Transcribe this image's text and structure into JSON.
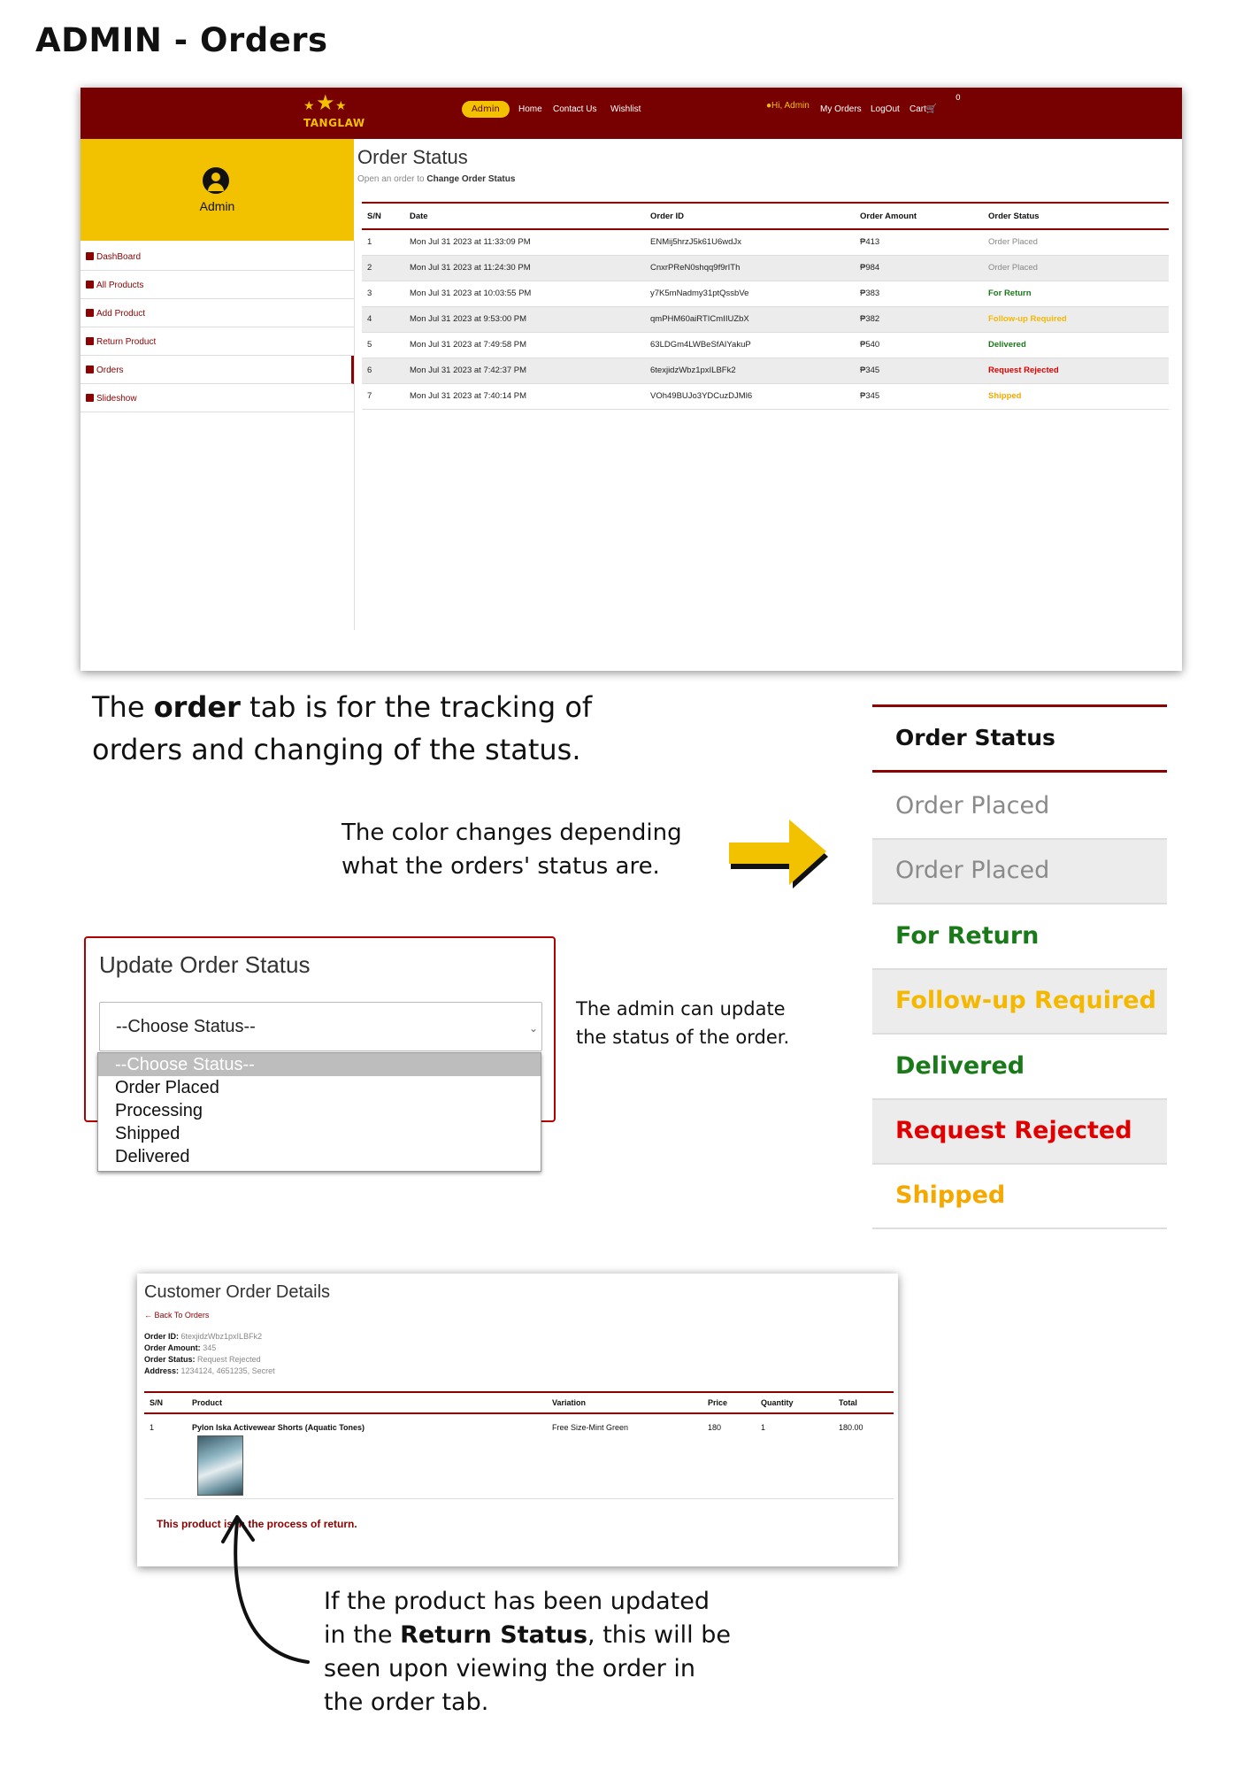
{
  "doc": {
    "title": "ADMIN - Orders",
    "caption_order_tab_pre": "The ",
    "caption_order_tab_bold": "order",
    "caption_order_tab_post": " tab is for the tracking of orders and changing of the status.",
    "caption_color": "The color changes depending what the orders' status are.",
    "caption_update": "The admin can update the status of the order.",
    "caption_return_pre": "If the product has been updated in the ",
    "caption_return_bold": "Return Status",
    "caption_return_post": ", this will be seen upon viewing the order in the order tab."
  },
  "colors": {
    "brand_maroon": "#770000",
    "brand_yellow": "#f2c200",
    "status_order_placed": "#888888",
    "status_for_return": "#1a7a1a",
    "status_follow_up": "#f5b800",
    "status_delivered": "#1a7a1a",
    "status_request_rejected": "#e00000",
    "status_shipped": "#f5a800"
  },
  "navbar": {
    "logo_text": "TANGLAW",
    "admin_pill": "Admin",
    "links": [
      "Home",
      "Contact Us",
      "Wishlist"
    ],
    "user_greeting": "Hi, Admin",
    "right_links": [
      "My Orders",
      "LogOut",
      "Cart"
    ],
    "cart_count": "0"
  },
  "sidebar": {
    "user_label": "Admin",
    "items": [
      {
        "label": "DashBoard",
        "icon": "dashboard-icon"
      },
      {
        "label": "All Products",
        "icon": "products-icon"
      },
      {
        "label": "Add Product",
        "icon": "add-icon"
      },
      {
        "label": "Return Product",
        "icon": "return-icon"
      },
      {
        "label": "Orders",
        "icon": "orders-icon"
      },
      {
        "label": "Slideshow",
        "icon": "slideshow-icon"
      }
    ]
  },
  "orders": {
    "title": "Order Status",
    "hint": "Open an order to ",
    "hint_bold": "Change Order Status",
    "columns": [
      "S/N",
      "Date",
      "Order ID",
      "Order Amount",
      "Order Status"
    ],
    "rows": [
      {
        "sn": "1",
        "date": "Mon Jul 31 2023 at 11:33:09 PM",
        "id": "ENMij5hrzJ5k61U6wdJx",
        "amount": "₱413",
        "status": "Order Placed",
        "color": "#888888"
      },
      {
        "sn": "2",
        "date": "Mon Jul 31 2023 at 11:24:30 PM",
        "id": "CnxrPReN0shqq9f9rITh",
        "amount": "₱984",
        "status": "Order Placed",
        "color": "#888888"
      },
      {
        "sn": "3",
        "date": "Mon Jul 31 2023 at 10:03:55 PM",
        "id": "y7K5mNadmy31ptQssbVe",
        "amount": "₱383",
        "status": "For Return",
        "color": "#1a7a1a"
      },
      {
        "sn": "4",
        "date": "Mon Jul 31 2023 at 9:53:00 PM",
        "id": "qmPHM60aiRTICmIIUZbX",
        "amount": "₱382",
        "status": "Follow-up Required",
        "color": "#f5b800"
      },
      {
        "sn": "5",
        "date": "Mon Jul 31 2023 at 7:49:58 PM",
        "id": "63LDGm4LWBeSfAIYakuP",
        "amount": "₱540",
        "status": "Delivered",
        "color": "#1a7a1a"
      },
      {
        "sn": "6",
        "date": "Mon Jul 31 2023 at 7:42:37 PM",
        "id": "6texjidzWbz1pxILBFk2",
        "amount": "₱345",
        "status": "Request Rejected",
        "color": "#e00000"
      },
      {
        "sn": "7",
        "date": "Mon Jul 31 2023 at 7:40:14 PM",
        "id": "VOh49BUJo3YDCuzDJMl6",
        "amount": "₱345",
        "status": "Shipped",
        "color": "#f5a800"
      }
    ]
  },
  "status_panel": {
    "header": "Order Status",
    "items": [
      {
        "label": "Order Placed",
        "color": "#8a8a8a"
      },
      {
        "label": "Order Placed",
        "color": "#8a8a8a"
      },
      {
        "label": "For Return",
        "color": "#1a7a1a"
      },
      {
        "label": "Follow-up Required",
        "color": "#f5b800"
      },
      {
        "label": "Delivered",
        "color": "#1a7a1a"
      },
      {
        "label": "Request Rejected",
        "color": "#e00000"
      },
      {
        "label": "Shipped",
        "color": "#f5a800"
      }
    ]
  },
  "update": {
    "title": "Update Order Status",
    "selected": "--Choose Status--",
    "options": [
      "--Choose Status--",
      "Order Placed",
      "Processing",
      "Shipped",
      "Delivered"
    ]
  },
  "details": {
    "title": "Customer Order Details",
    "back": "← Back To Orders",
    "order_id_label": "Order ID:",
    "order_id": "6texjidzWbz1pxILBFk2",
    "amount_label": "Order Amount:",
    "amount": "345",
    "status_label": "Order Status:",
    "status": "Request Rejected",
    "address_label": "Address:",
    "address": "1234124, 4651235, Secret",
    "columns": [
      "S/N",
      "Product",
      "Variation",
      "Price",
      "Quantity",
      "Total"
    ],
    "row": {
      "sn": "1",
      "product": "Pylon Iska Activewear Shorts (Aquatic Tones)",
      "variation": "Free Size-Mint Green",
      "price": "180",
      "quantity": "1",
      "total": "180.00"
    },
    "return_note": "This product is in the process of return."
  }
}
